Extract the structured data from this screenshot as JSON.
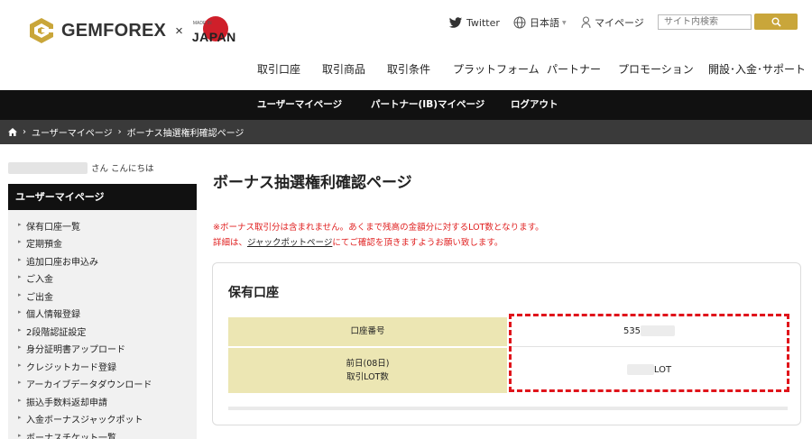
{
  "brand": {
    "name": "GEMFOREX",
    "times": "×",
    "made_in": "MADE IN",
    "japan": "JAPAN"
  },
  "utility": {
    "twitter": "Twitter",
    "language": "日本語",
    "mypage": "マイページ",
    "search_placeholder": "サイト内検索"
  },
  "main_nav": [
    "取引口座",
    "取引商品",
    "取引条件",
    "プラットフォーム",
    "パートナー",
    "プロモーション",
    "開設･入金･サポート"
  ],
  "user_nav": [
    "ユーザーマイページ",
    "パートナー(IB)マイページ",
    "ログアウト"
  ],
  "breadcrumb": [
    "ユーザーマイページ",
    "ボーナス抽選権利確認ページ"
  ],
  "sidebar": {
    "greeting": "さん こんにちは",
    "heading": "ユーザーマイページ",
    "items": [
      "保有口座一覧",
      "定期預金",
      "追加口座お申込み",
      "ご入金",
      "ご出金",
      "個人情報登録",
      "2段階認証設定",
      "身分証明書アップロード",
      "クレジットカード登録",
      "アーカイブデータダウンロード",
      "振込手数料返却申請",
      "入金ボーナスジャックポット",
      "ボーナスチケット一覧"
    ]
  },
  "content": {
    "title": "ボーナス抽選権利確認ページ",
    "note1": "※ボーナス取引分は含まれません。あくまで残高の金額分に対するLOT数となります。",
    "note2_pre": "詳細は、",
    "note2_link": "ジャックポットページ",
    "note2_post": "にてご確認を頂きますようお願い致します。",
    "card_title": "保有口座",
    "rows": [
      {
        "label": "口座番号",
        "value": "535"
      },
      {
        "label_line1": "前日(08日)",
        "label_line2": "取引LOT数",
        "value": "LOT"
      }
    ]
  },
  "colors": {
    "dark_bar": "#111111",
    "breadcrumb_bar": "#3a3a3a",
    "gold": "#c9a63a",
    "table_label_bg": "#ece6b3",
    "notice_red": "#e02020",
    "highlight_red": "#e0141b"
  }
}
